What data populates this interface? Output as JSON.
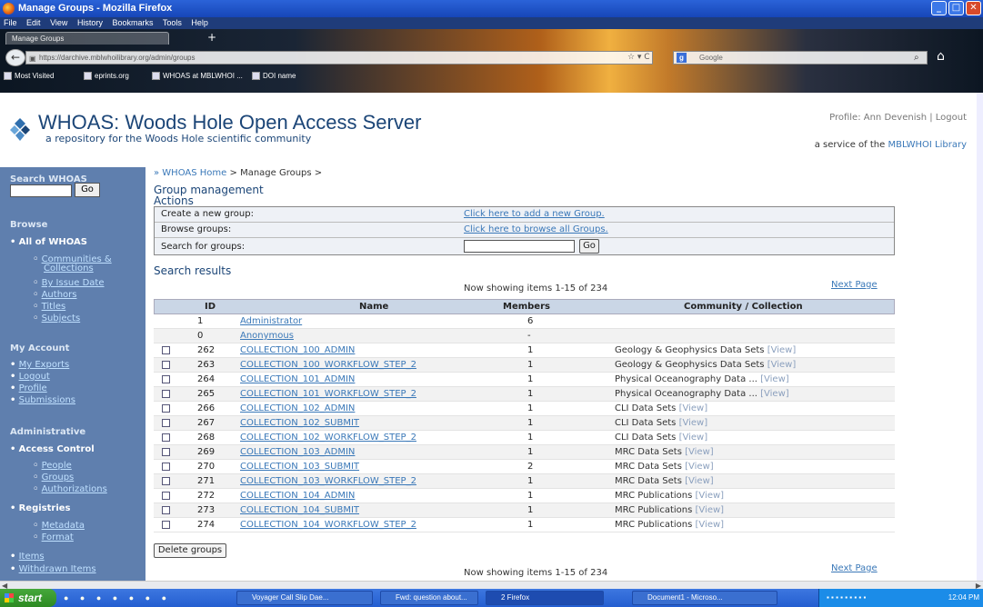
{
  "window": {
    "title": "Manage Groups - Mozilla Firefox"
  },
  "menu": [
    "File",
    "Edit",
    "View",
    "History",
    "Bookmarks",
    "Tools",
    "Help"
  ],
  "tab": {
    "label": "Manage Groups",
    "new_tab": "+"
  },
  "url": "https://darchive.mblwhoilibrary.org/admin/groups",
  "search_engine": {
    "label": "Google"
  },
  "bookmarks": [
    "Most Visited",
    "eprints.org",
    "WHOAS at MBLWHOI ...",
    "DOI name"
  ],
  "site": {
    "title": "WHOAS: Woods Hole Open Access Server",
    "subtitle": "a repository for the Woods Hole scientific community",
    "profile": "Profile: Ann Devenish | Logout",
    "service_prefix": "a service of the",
    "service_link": "MBLWHOI Library"
  },
  "sidebar": {
    "search_heading": "Search WHOAS",
    "go": "Go",
    "browse_heading": "Browse",
    "all_of": "All of WHOAS",
    "browse_items": [
      "Communities &",
      "Collections",
      "By Issue Date",
      "Authors",
      "Titles",
      "Subjects"
    ],
    "account_heading": "My Account",
    "account_items": [
      "My Exports",
      "Logout",
      "Profile",
      "Submissions"
    ],
    "admin_heading": "Administrative",
    "access_control": "Access Control",
    "access_items": [
      "People",
      "Groups",
      "Authorizations"
    ],
    "registries": "Registries",
    "registry_items": [
      "Metadata",
      "Format"
    ],
    "admin_items": [
      "Items",
      "Withdrawn Items"
    ]
  },
  "breadcrumb": {
    "home": "WHOAS Home",
    "current": "Manage Groups"
  },
  "page": {
    "title": "Group management",
    "actions_heading": "Actions",
    "actions": [
      {
        "label": "Create a new group:",
        "link": "Click here to add a new Group."
      },
      {
        "label": "Browse groups:",
        "link": "Click here to browse all Groups."
      },
      {
        "label": "Search for groups:",
        "link": ""
      }
    ],
    "search_go": "Go",
    "results_heading": "Search results",
    "showing": "Now showing items 1-15 of 234",
    "next_page": "Next Page",
    "delete_button": "Delete groups"
  },
  "table": {
    "columns": [
      "ID",
      "Name",
      "Members",
      "Community / Collection"
    ],
    "view_label": "[View]",
    "rows": [
      {
        "id": "1",
        "name": "Administrator",
        "members": "6",
        "collection": "",
        "checkbox": false
      },
      {
        "id": "0",
        "name": "Anonymous",
        "members": "-",
        "collection": "",
        "checkbox": false
      },
      {
        "id": "262",
        "name": "COLLECTION_100_ADMIN",
        "members": "1",
        "collection": "Geology & Geophysics Data Sets",
        "checkbox": true
      },
      {
        "id": "263",
        "name": "COLLECTION_100_WORKFLOW_STEP_2",
        "members": "1",
        "collection": "Geology & Geophysics Data Sets",
        "checkbox": true
      },
      {
        "id": "264",
        "name": "COLLECTION_101_ADMIN",
        "members": "1",
        "collection": "Physical Oceanography Data ...",
        "checkbox": true
      },
      {
        "id": "265",
        "name": "COLLECTION_101_WORKFLOW_STEP_2",
        "members": "1",
        "collection": "Physical Oceanography Data ...",
        "checkbox": true
      },
      {
        "id": "266",
        "name": "COLLECTION_102_ADMIN",
        "members": "1",
        "collection": "CLI Data Sets",
        "checkbox": true
      },
      {
        "id": "267",
        "name": "COLLECTION_102_SUBMIT",
        "members": "1",
        "collection": "CLI Data Sets",
        "checkbox": true
      },
      {
        "id": "268",
        "name": "COLLECTION_102_WORKFLOW_STEP_2",
        "members": "1",
        "collection": "CLI Data Sets",
        "checkbox": true
      },
      {
        "id": "269",
        "name": "COLLECTION_103_ADMIN",
        "members": "1",
        "collection": "MRC Data Sets",
        "checkbox": true
      },
      {
        "id": "270",
        "name": "COLLECTION_103_SUBMIT",
        "members": "2",
        "collection": "MRC Data Sets",
        "checkbox": true
      },
      {
        "id": "271",
        "name": "COLLECTION_103_WORKFLOW_STEP_2",
        "members": "1",
        "collection": "MRC Data Sets",
        "checkbox": true
      },
      {
        "id": "272",
        "name": "COLLECTION_104_ADMIN",
        "members": "1",
        "collection": "MRC Publications",
        "checkbox": true
      },
      {
        "id": "273",
        "name": "COLLECTION_104_SUBMIT",
        "members": "1",
        "collection": "MRC Publications",
        "checkbox": true
      },
      {
        "id": "274",
        "name": "COLLECTION_104_WORKFLOW_STEP_2",
        "members": "1",
        "collection": "MRC Publications",
        "checkbox": true
      }
    ]
  },
  "taskbar": {
    "start": "start",
    "tasks": [
      "Voyager Call Slip Dae...",
      "Fwd: question about...",
      "2 Firefox",
      "Document1 - Microso..."
    ],
    "clock": "12:04 PM"
  }
}
